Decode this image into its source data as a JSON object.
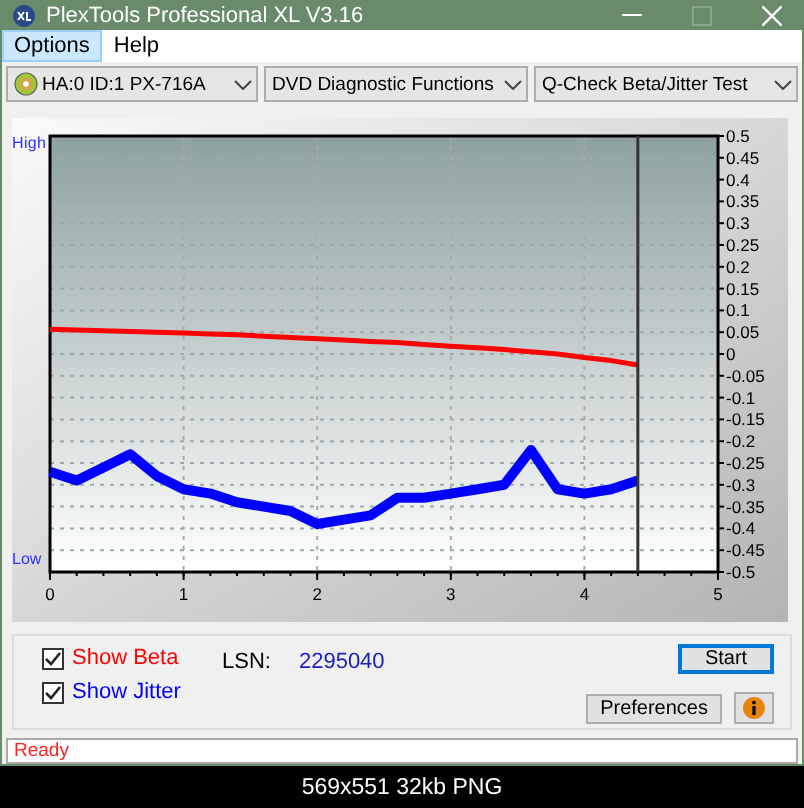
{
  "window": {
    "title": "PlexTools Professional XL V3.16"
  },
  "menu": [
    {
      "label": "Options",
      "selected": true
    },
    {
      "label": "Help",
      "selected": false
    }
  ],
  "toolbar": {
    "drive": "HA:0 ID:1  PX-716A",
    "function": "DVD Diagnostic Functions",
    "test": "Q-Check Beta/Jitter Test"
  },
  "chart": {
    "high_label": "High",
    "low_label": "Low",
    "chart_data": {
      "type": "line",
      "x": [
        0,
        0.2,
        0.4,
        0.6,
        0.8,
        1.0,
        1.2,
        1.4,
        1.6,
        1.8,
        2.0,
        2.2,
        2.4,
        2.6,
        2.8,
        3.0,
        3.2,
        3.4,
        3.6,
        3.8,
        4.0,
        4.2,
        4.4
      ],
      "series": [
        {
          "color": "#ff0000",
          "values": [
            0.057,
            0.055,
            0.053,
            0.052,
            0.05,
            0.048,
            0.046,
            0.044,
            0.041,
            0.038,
            0.035,
            0.032,
            0.029,
            0.026,
            0.022,
            0.018,
            0.014,
            0.01,
            0.005,
            0.0,
            -0.008,
            -0.015,
            -0.025
          ]
        },
        {
          "color": "#0000ff",
          "values": [
            -0.27,
            -0.29,
            -0.26,
            -0.23,
            -0.28,
            -0.31,
            -0.32,
            -0.34,
            -0.35,
            -0.36,
            -0.39,
            -0.38,
            -0.37,
            -0.33,
            -0.33,
            -0.32,
            -0.31,
            -0.3,
            -0.22,
            -0.31,
            -0.32,
            -0.31,
            -0.29
          ]
        }
      ],
      "xlim": [
        0,
        5
      ],
      "ylim": [
        -0.5,
        0.5
      ],
      "xticks": [
        0,
        1,
        2,
        3,
        4,
        5
      ],
      "yticks": [
        0.5,
        0.45,
        0.4,
        0.35,
        0.3,
        0.25,
        0.2,
        0.15,
        0.1,
        0.05,
        0,
        -0.05,
        -0.1,
        -0.15,
        -0.2,
        -0.25,
        -0.3,
        -0.35,
        -0.4,
        -0.45,
        -0.5
      ],
      "grid": true,
      "ref_lines": [
        {
          "axis": "x",
          "value": 4.4
        }
      ]
    }
  },
  "options": [
    {
      "label": "Show Beta",
      "checked": true,
      "color": "#ff0000"
    },
    {
      "label": "Show Jitter",
      "checked": true,
      "color": "#0000ff"
    }
  ],
  "lsn": {
    "label": "LSN:",
    "value": "2295040"
  },
  "buttons": {
    "start": "Start",
    "preferences": "Preferences"
  },
  "status": "Ready",
  "caption": "569x551 32kb PNG"
}
